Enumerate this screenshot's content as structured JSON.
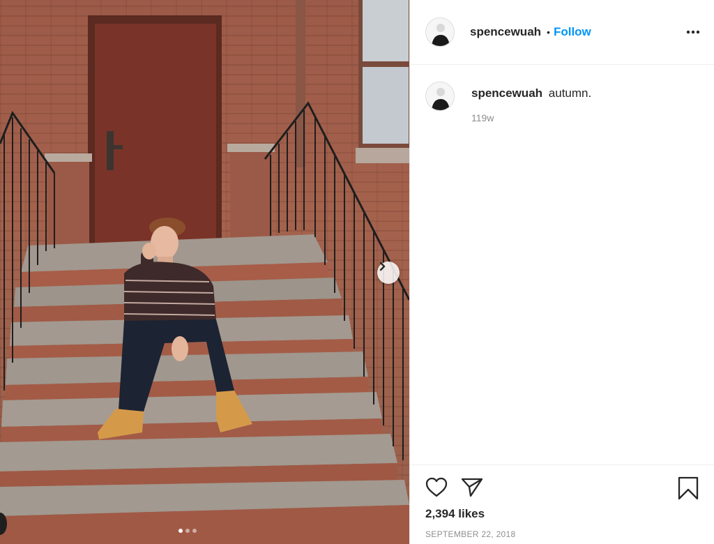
{
  "post": {
    "photo_alt": "",
    "carousel": {
      "total": 3,
      "active": 1
    }
  },
  "header": {
    "username": "spencewuah",
    "separator": "•",
    "follow_label": "Follow"
  },
  "caption": {
    "username": "spencewuah",
    "text": "autumn.",
    "age": "119w"
  },
  "actions": {
    "like_icon": "heart-icon",
    "share_icon": "paper-plane-icon",
    "save_icon": "bookmark-icon"
  },
  "likes_text": "2,394 likes",
  "date_text": "SEPTEMBER 22, 2018",
  "colors": {
    "accent": "#0095f6",
    "text": "#262626",
    "muted": "#8e8e8e",
    "border": "#efefef"
  }
}
